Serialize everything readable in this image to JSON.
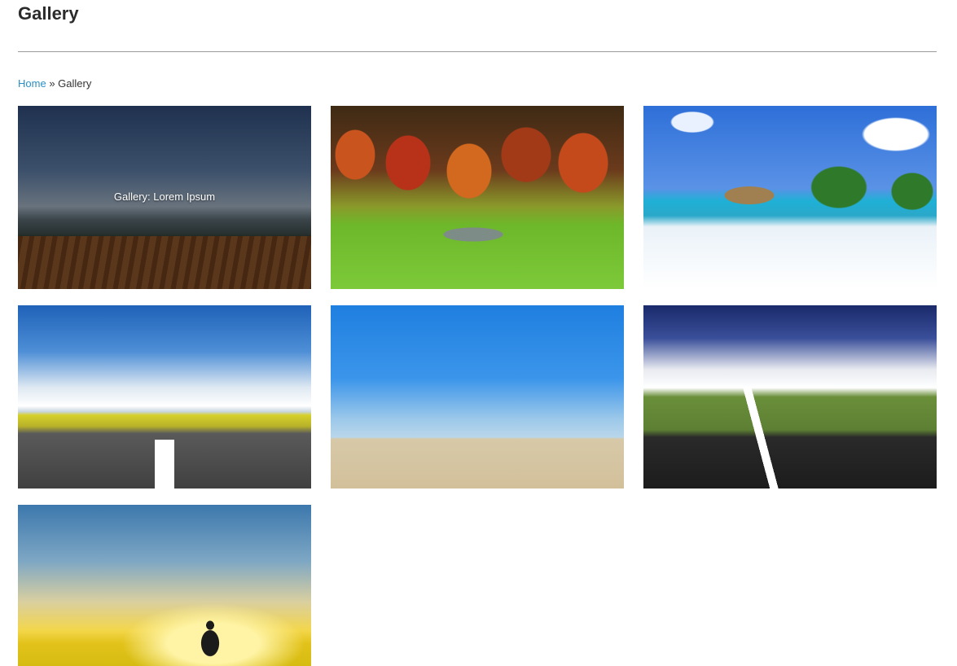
{
  "page": {
    "title": "Gallery"
  },
  "breadcrumb": {
    "home_label": "Home",
    "separator": "»",
    "current_label": "Gallery"
  },
  "gallery": {
    "items": [
      {
        "name": "field-mountains",
        "hover_caption": "Gallery: Lorem Ipsum"
      },
      {
        "name": "autumn-trees"
      },
      {
        "name": "tropical-beach"
      },
      {
        "name": "road-fields"
      },
      {
        "name": "desert-sky"
      },
      {
        "name": "motion-road"
      },
      {
        "name": "sunlight-man"
      }
    ]
  },
  "colors": {
    "link": "#2a8fc4",
    "title": "#2b2b2b",
    "divider": "#9a9a9a"
  }
}
